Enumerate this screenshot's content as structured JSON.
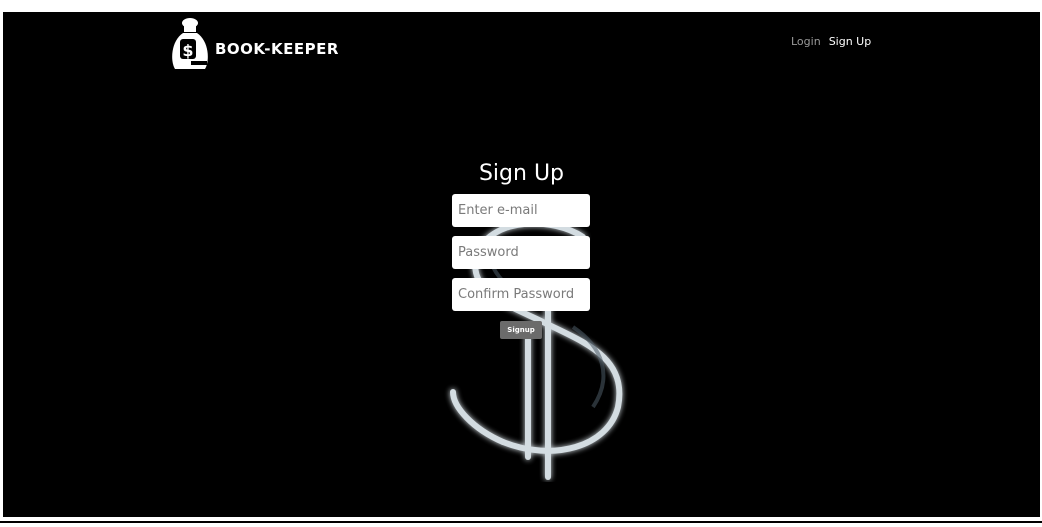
{
  "header": {
    "logo_text": "BOOK-KEEPER",
    "logo_icon": "money-bag-icon",
    "nav": {
      "login_label": "Login",
      "signup_label": "Sign Up"
    }
  },
  "form": {
    "title": "Sign Up",
    "email_placeholder": "Enter e-mail",
    "email_value": "",
    "password_placeholder": "Password",
    "password_value": "",
    "confirm_placeholder": "Confirm Password",
    "confirm_value": "",
    "submit_label": "Signup"
  },
  "background": {
    "icon": "neon-dollar-sign",
    "color": "#000000"
  },
  "colors": {
    "page_bg": "#000000",
    "text": "#ffffff",
    "button": "#6b6b6b",
    "nav_inactive": "#9a9a9a"
  }
}
